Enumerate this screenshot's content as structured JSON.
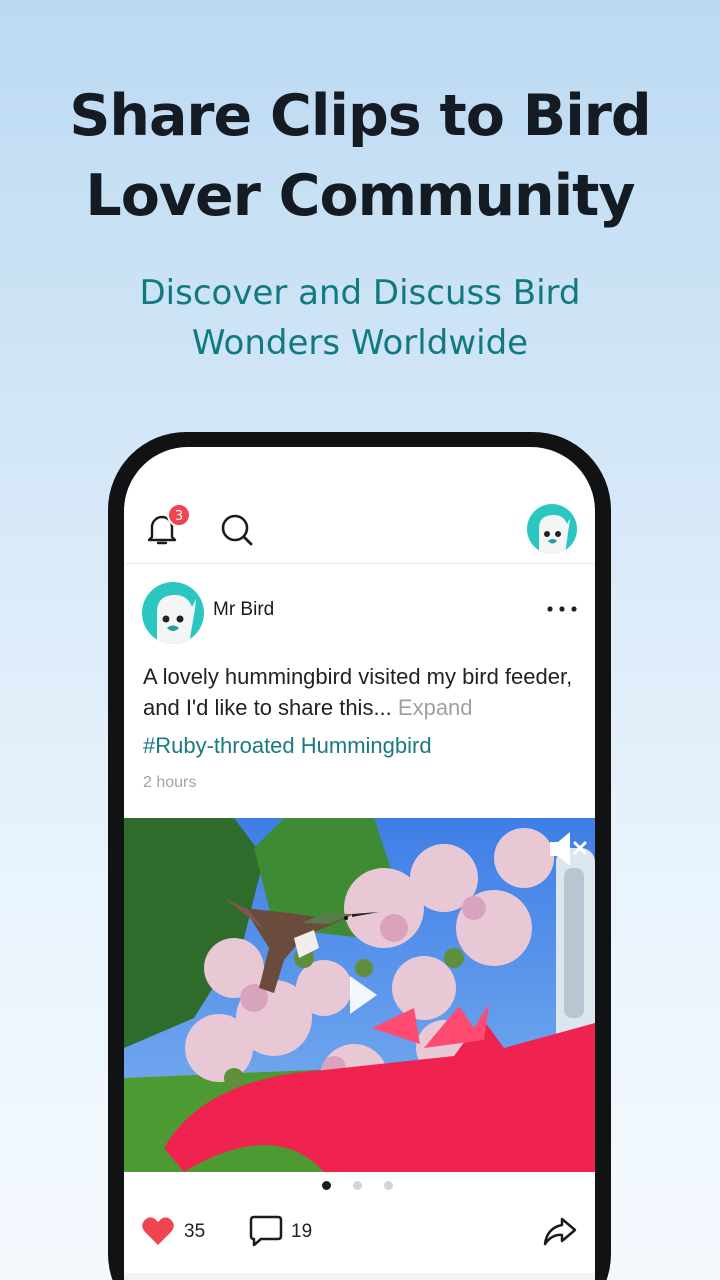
{
  "promo": {
    "headline_line1": "Share Clips to Bird",
    "headline_line2": "Lover Community",
    "subhead_line1": "Discover and Discuss Bird",
    "subhead_line2": "Wonders Worldwide"
  },
  "topbar": {
    "notification_count": "3",
    "icons": [
      "bell-icon",
      "search-icon",
      "profile-avatar"
    ]
  },
  "post": {
    "username": "Mr Bird",
    "text": "A lovely hummingbird visited my bird feeder, and I'd like to share this...",
    "expand_label": "Expand",
    "hashtag": "#Ruby-throated Hummingbird",
    "time": "2 hours",
    "media_icons": [
      "mute-icon",
      "play-icon"
    ],
    "carousel": {
      "count": 3,
      "active": 0
    },
    "likes": "35",
    "comments": "19"
  },
  "colors": {
    "accent": "#117a80",
    "badge": "#f0454e",
    "like": "#f0454e",
    "avatar": "#2cc6c0"
  }
}
